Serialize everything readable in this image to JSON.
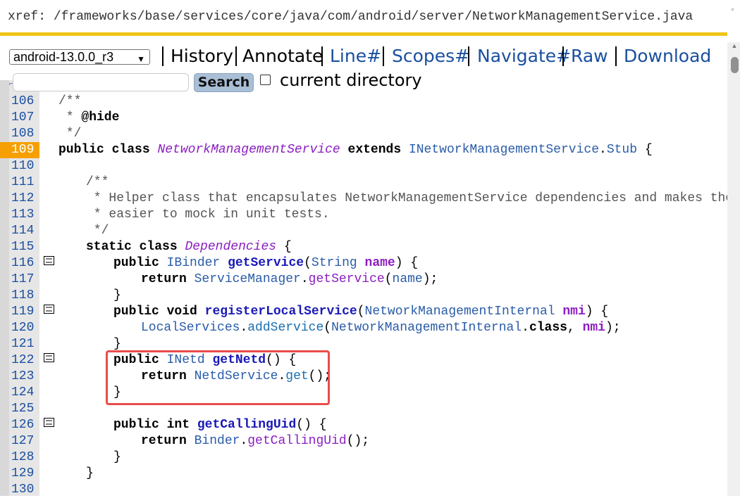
{
  "xref": {
    "prefix": "xref: ",
    "path_parts": [
      "/frameworks",
      "/base",
      "/services",
      "/core",
      "/java",
      "/com",
      "/android",
      "/server",
      "/NetworkManagementService.java"
    ]
  },
  "toolbar": {
    "version": "android-13.0.0_r3",
    "history": "History",
    "annotate": "Annotate",
    "line": "Line#",
    "scopes": "Scopes#",
    "navigate": "Navigate#",
    "raw": "Raw",
    "download": "Download"
  },
  "search": {
    "placeholder": "",
    "button": "Search",
    "current_directory": "current directory"
  },
  "highlighted_line": "109",
  "lines": [
    {
      "n": "106"
    },
    {
      "n": "107"
    },
    {
      "n": "108"
    },
    {
      "n": "109"
    },
    {
      "n": "110"
    },
    {
      "n": "111"
    },
    {
      "n": "112"
    },
    {
      "n": "113"
    },
    {
      "n": "114"
    },
    {
      "n": "115"
    },
    {
      "n": "116"
    },
    {
      "n": "117"
    },
    {
      "n": "118"
    },
    {
      "n": "119"
    },
    {
      "n": "120"
    },
    {
      "n": "121"
    },
    {
      "n": "122"
    },
    {
      "n": "123"
    },
    {
      "n": "124"
    },
    {
      "n": "125"
    },
    {
      "n": "126"
    },
    {
      "n": "127"
    },
    {
      "n": "128"
    },
    {
      "n": "129"
    },
    {
      "n": "130"
    }
  ],
  "code": {
    "l106": "/**",
    "l107_star": " * ",
    "l107_tag": "@hide",
    "l108": " */",
    "l109_public": "public",
    "l109_class": "class",
    "l109_name": "NetworkManagementService",
    "l109_extends": "extends",
    "l109_iface": "INetworkManagementService",
    "l109_dot": ".",
    "l109_stub": "Stub",
    "l109_brace": " {",
    "l111": "/**",
    "l112": " * Helper class that encapsulates NetworkManagementService dependencies and makes them",
    "l113": " * easier to mock in unit tests.",
    "l114": " */",
    "l115_static": "static",
    "l115_class": "class",
    "l115_name": "Dependencies",
    "l115_brace": " {",
    "l116_public": "public",
    "l116_type": "IBinder",
    "l116_method": "getService",
    "l116_ptype": "String",
    "l116_param": "name",
    "l117_return": "return",
    "l117_type": "ServiceManager",
    "l117_method": "getService",
    "l117_arg": "name",
    "l119_public": "public",
    "l119_void": "void",
    "l119_method": "registerLocalService",
    "l119_ptype": "NetworkManagementInternal",
    "l119_param": "nmi",
    "l120_type": "LocalServices",
    "l120_method": "addService",
    "l120_ptype": "NetworkManagementInternal",
    "l120_class": "class",
    "l120_arg": "nmi",
    "l122_public": "public",
    "l122_type": "INetd",
    "l122_method": "getNetd",
    "l123_return": "return",
    "l123_type": "NetdService",
    "l123_method": "get",
    "l126_public": "public",
    "l126_int": "int",
    "l126_method": "getCallingUid",
    "l127_return": "return",
    "l127_type": "Binder",
    "l127_method": "getCallingUid"
  }
}
